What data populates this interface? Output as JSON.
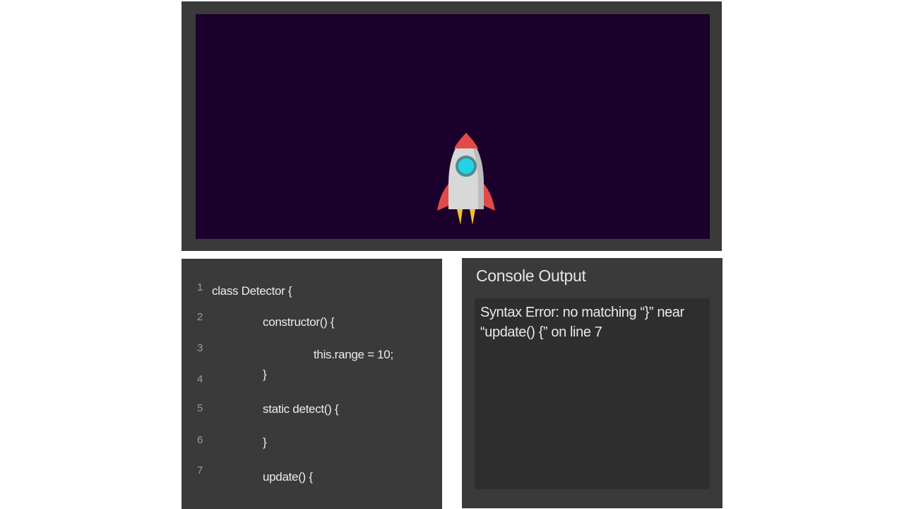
{
  "code": {
    "lines": [
      {
        "num": "1",
        "text": "class Detector {"
      },
      {
        "num": "2",
        "text": "constructor() {"
      },
      {
        "num": "3",
        "text": "this.range = 10;"
      },
      {
        "num": "",
        "text": "}"
      },
      {
        "num": "4",
        "text": ""
      },
      {
        "num": "5",
        "text": "static detect() {"
      },
      {
        "num": "6",
        "text": "}"
      },
      {
        "num": "7",
        "text": "update() {"
      }
    ]
  },
  "console": {
    "title": "Console Output",
    "message": "Syntax Error: no matching “}” near “update() {” on line 7"
  },
  "stage": {
    "sprite": "rocket-icon",
    "background_color": "#1c002c"
  }
}
